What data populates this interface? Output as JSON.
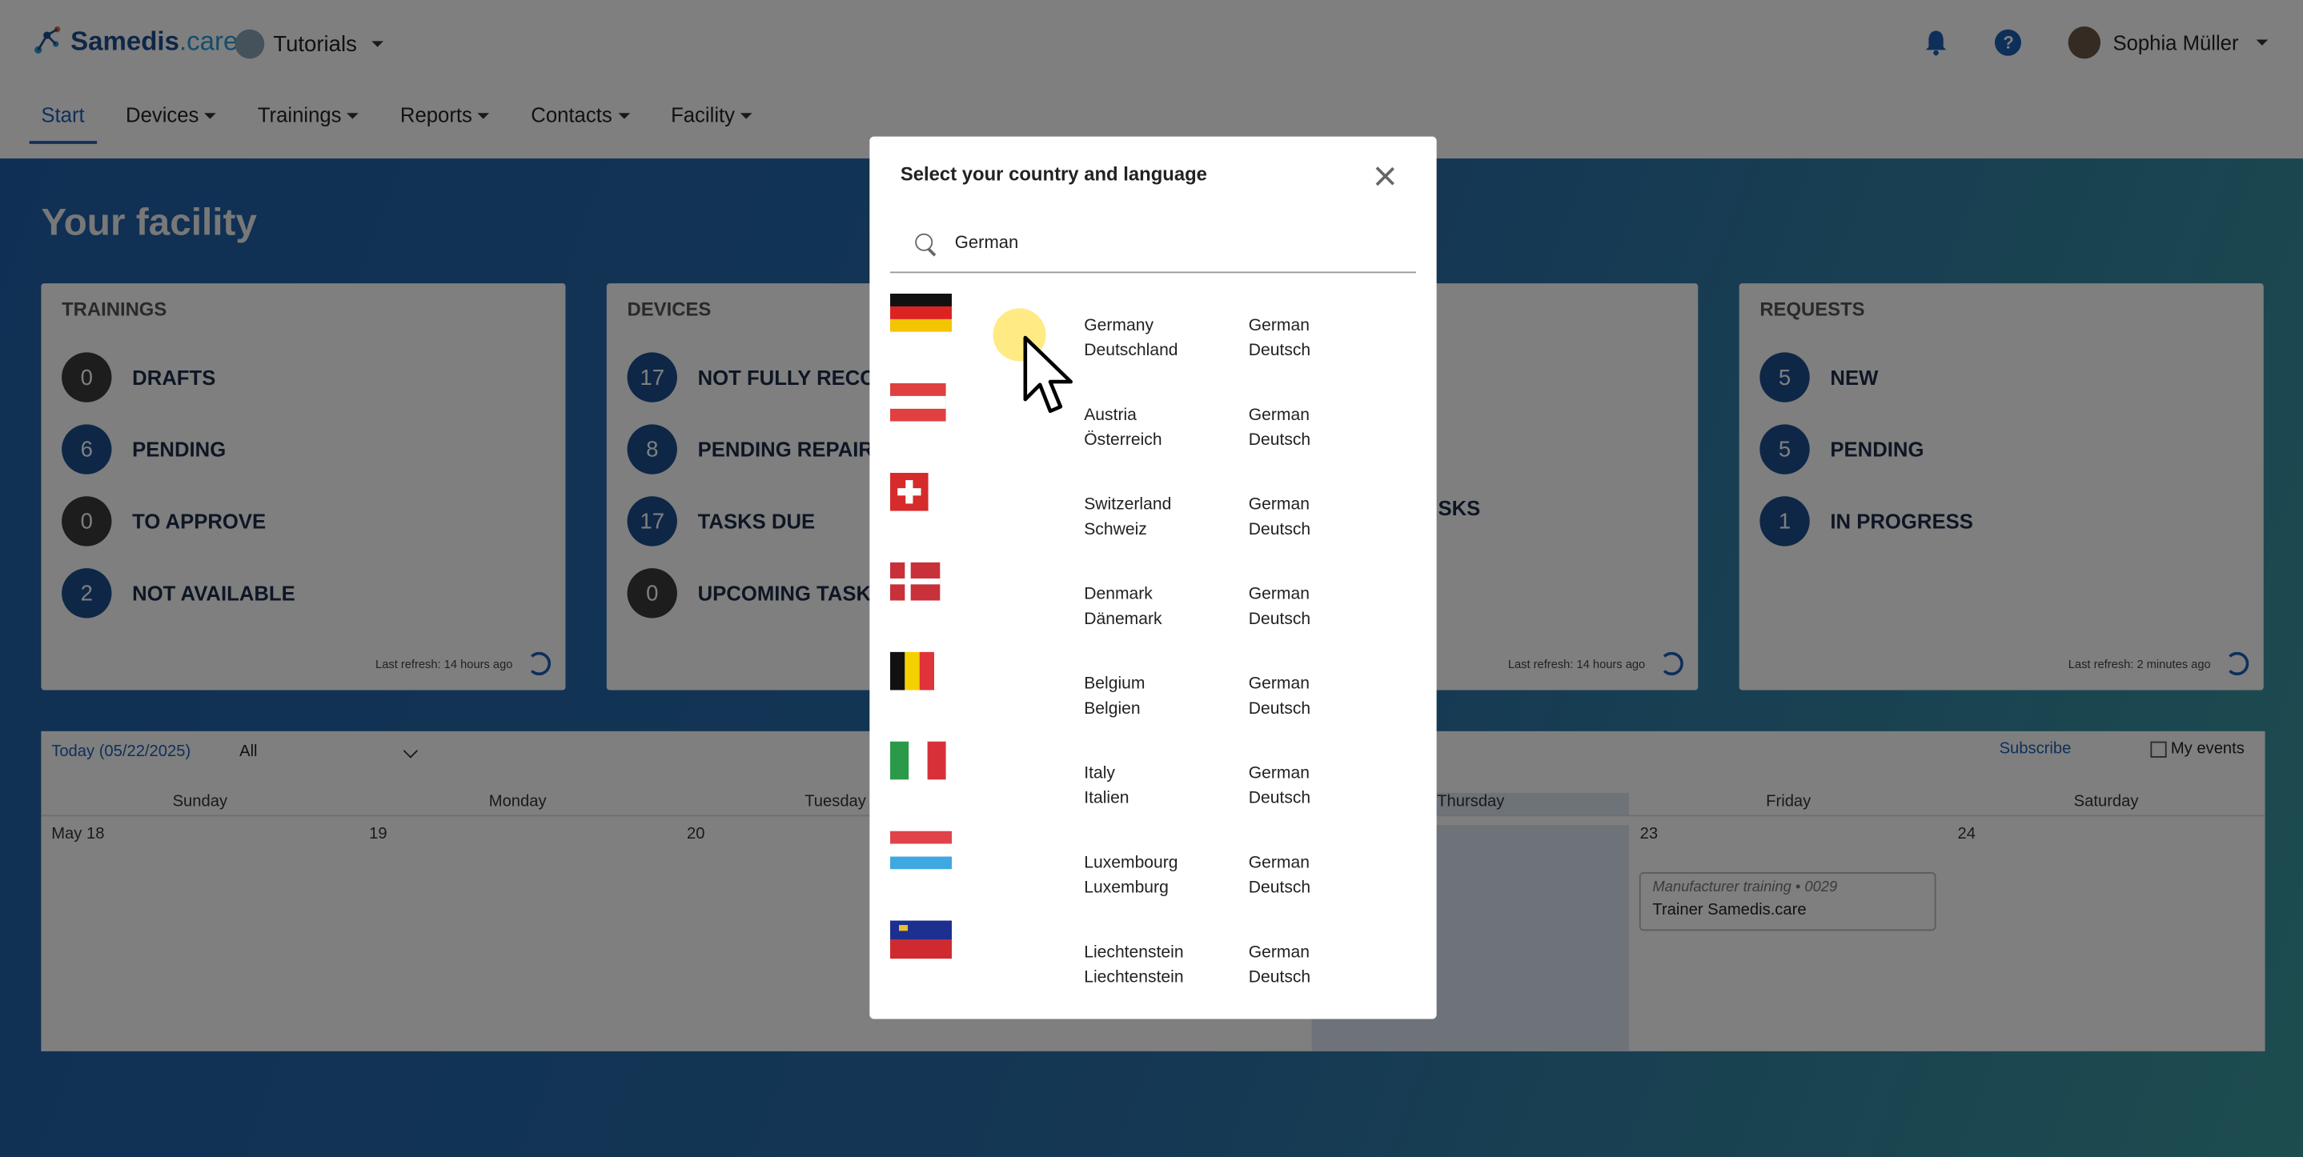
{
  "app": {
    "brand_main": "Samedis",
    "brand_care": ".care",
    "tenant": "Tutorials",
    "user": "Sophia Müller"
  },
  "nav": [
    "Start",
    "Devices",
    "Trainings",
    "Reports",
    "Contacts",
    "Facility"
  ],
  "hero_title": "Your facility",
  "cards": [
    {
      "title": "TRAININGS",
      "stats": [
        {
          "count": "0",
          "label": "DRAFTS",
          "tone": "dark"
        },
        {
          "count": "6",
          "label": "PENDING",
          "tone": "blue"
        },
        {
          "count": "0",
          "label": "TO APPROVE",
          "tone": "dark"
        },
        {
          "count": "2",
          "label": "NOT AVAILABLE",
          "tone": "blue"
        }
      ],
      "refresh": "Last refresh: 14 hours ago"
    },
    {
      "title": "DEVICES",
      "stats": [
        {
          "count": "17",
          "label": "NOT FULLY RECOR",
          "tone": "blue"
        },
        {
          "count": "8",
          "label": "PENDING REPAIRS",
          "tone": "blue"
        },
        {
          "count": "17",
          "label": "TASKS DUE",
          "tone": "blue"
        },
        {
          "count": "0",
          "label": "UPCOMING TASKS",
          "tone": "dark"
        }
      ],
      "refresh": ""
    },
    {
      "title": "",
      "stats": [
        {
          "count": "",
          "label": "SKS",
          "tone": "none"
        }
      ],
      "refresh": "Last refresh: 14 hours ago"
    },
    {
      "title": "REQUESTS",
      "stats": [
        {
          "count": "5",
          "label": "NEW",
          "tone": "blue"
        },
        {
          "count": "5",
          "label": "PENDING",
          "tone": "blue"
        },
        {
          "count": "1",
          "label": "IN PROGRESS",
          "tone": "blue"
        }
      ],
      "refresh": "Last refresh: 2 minutes ago"
    }
  ],
  "calendar": {
    "today": "Today (05/22/2025)",
    "filter": "All",
    "subscribe": "Subscribe",
    "my_events": "My events",
    "days": [
      "Sunday",
      "Monday",
      "Tuesday",
      "",
      "Thursday",
      "Friday",
      "Saturday"
    ],
    "dates": [
      "May 18",
      "19",
      "20",
      "",
      "",
      "23",
      "24"
    ],
    "event": {
      "type": "Manufacturer training • 0029",
      "trainer": "Trainer Samedis.care"
    }
  },
  "modal": {
    "title": "Select your country and language",
    "search_value": "German",
    "rows": [
      {
        "flag": "germany",
        "country": "Germany",
        "country_native": "Deutschland",
        "lang": "German",
        "lang_native": "Deutsch"
      },
      {
        "flag": "austria",
        "country": "Austria",
        "country_native": "Österreich",
        "lang": "German",
        "lang_native": "Deutsch"
      },
      {
        "flag": "switzerland",
        "country": "Switzerland",
        "country_native": "Schweiz",
        "lang": "German",
        "lang_native": "Deutsch"
      },
      {
        "flag": "denmark",
        "country": "Denmark",
        "country_native": "Dänemark",
        "lang": "German",
        "lang_native": "Deutsch"
      },
      {
        "flag": "belgium",
        "country": "Belgium",
        "country_native": "Belgien",
        "lang": "German",
        "lang_native": "Deutsch"
      },
      {
        "flag": "italy",
        "country": "Italy",
        "country_native": "Italien",
        "lang": "German",
        "lang_native": "Deutsch"
      },
      {
        "flag": "luxembourg",
        "country": "Luxembourg",
        "country_native": "Luxemburg",
        "lang": "German",
        "lang_native": "Deutsch"
      },
      {
        "flag": "liechtenstein",
        "country": "Liechtenstein",
        "country_native": "Liechtenstein",
        "lang": "German",
        "lang_native": "Deutsch"
      }
    ]
  }
}
